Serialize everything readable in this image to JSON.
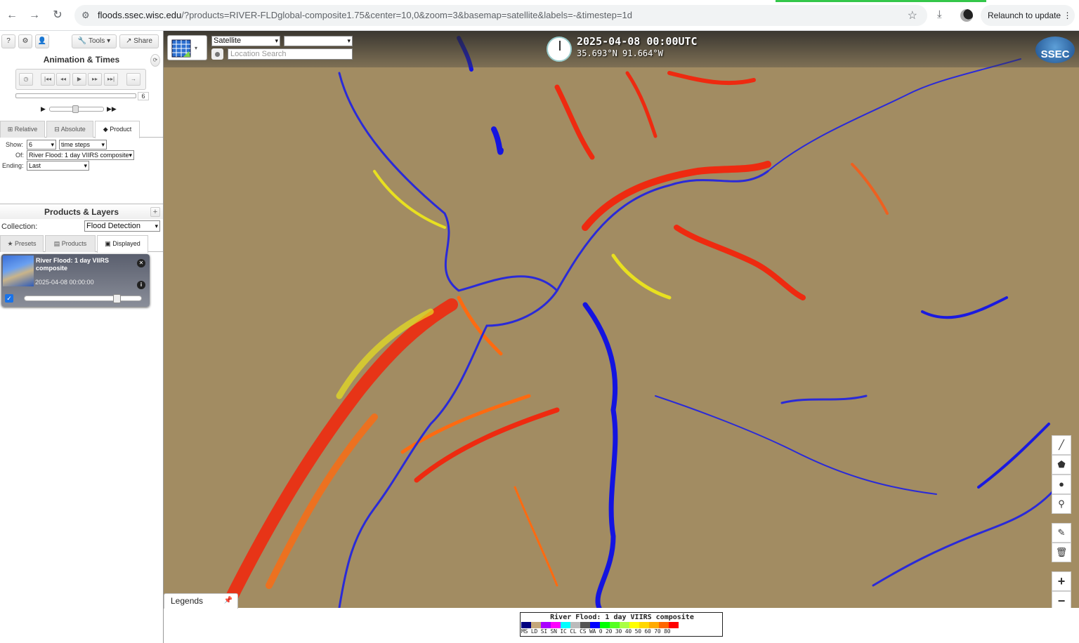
{
  "browser": {
    "url_host": "floods.ssec.wisc.edu",
    "url_rest": "/?products=RIVER-FLDglobal-composite1.75&center=10,0&zoom=3&basemap=satellite&labels=-&timestep=1d",
    "relaunch_label": "Relaunch to update"
  },
  "sidebar": {
    "top_buttons": {
      "help": "?",
      "settings": "⚙",
      "user": "👤",
      "tools": "Tools",
      "share": "Share"
    },
    "animation": {
      "title": "Animation & Times",
      "slider_value": "6",
      "tabs": [
        "Relative",
        "Absolute",
        "Product"
      ],
      "active_tab": "Product",
      "show_label": "Show:",
      "show_value": "6",
      "show_unit": "time steps",
      "of_label": "Of:",
      "of_value": "River Flood: 1 day VIIRS composite",
      "ending_label": "Ending:",
      "ending_value": "Last"
    },
    "products": {
      "title": "Products & Layers",
      "collection_label": "Collection:",
      "collection_value": "Flood Detection",
      "tabs": [
        "Presets",
        "Products",
        "Displayed"
      ],
      "active_tab": "Displayed"
    },
    "layer": {
      "name": "River Flood: 1 day VIIRS composite",
      "time": "2025-04-08 00:00:00",
      "opacity": 0.8,
      "visible": true
    }
  },
  "map": {
    "basemap": "Satellite",
    "labels": "",
    "search_placeholder": "Location Search",
    "time": "2025-04-08 00:00UTC",
    "coords": "35.693°N 91.664°W",
    "logo": "SSEC",
    "legends_tab": "Legends",
    "zoom_in": "+",
    "zoom_out": "−"
  },
  "legend": {
    "title": "River Flood: 1 day VIIRS composite",
    "codes": "MS LD SI SN IC CL CS WA 0  20 30 40 50 60 70 80",
    "colors": [
      "#000080",
      "#c4a77a",
      "#aa00ff",
      "#ff00ff",
      "#00ffff",
      "#bbbbbb",
      "#555555",
      "#0000ff",
      "#00ff00",
      "#55ff22",
      "#aaff44",
      "#ffff00",
      "#ffd700",
      "#ffaa00",
      "#ff6600",
      "#ff0000"
    ]
  }
}
